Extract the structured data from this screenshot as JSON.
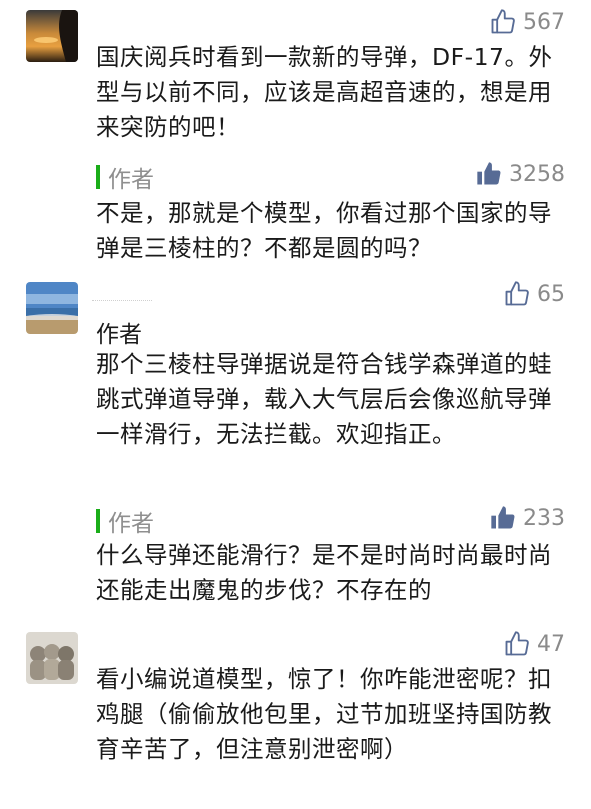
{
  "comments": [
    {
      "likes": "567",
      "text": "国庆阅兵时看到一款新的导弹，DF-17。外型与以前不同，应该是高超音速的，想是用来突防的吧！",
      "reply": {
        "label": "作者",
        "likes": "3258",
        "text": "不是，那就是个模型，你看过那个国家的导弹是三棱柱的？不都是圆的吗？"
      }
    },
    {
      "likes": "65",
      "name": "作者",
      "text": "那个三棱柱导弹据说是符合钱学森弹道的蛙跳式弹道导弹，载入大气层后会像巡航导弹一样滑行，无法拦截。欢迎指正。",
      "reply": {
        "label": "作者",
        "likes": "233",
        "text": "什么导弹还能滑行？是不是时尚时尚最时尚还能走出魔鬼的步伐？不存在的"
      }
    },
    {
      "likes": "47",
      "text": "看小编说道模型，惊了！你咋能泄密呢？扣鸡腿（偷偷放他包里，过节加班坚持国防教育辛苦了，但注意别泄密啊）"
    }
  ],
  "colors": {
    "accent": "#1aad19",
    "muted": "#8a8a8a",
    "like_filled": "#576b95"
  },
  "icons": {
    "like_outline": "thumbs-up-outline-icon",
    "like_filled": "thumbs-up-filled-icon"
  }
}
